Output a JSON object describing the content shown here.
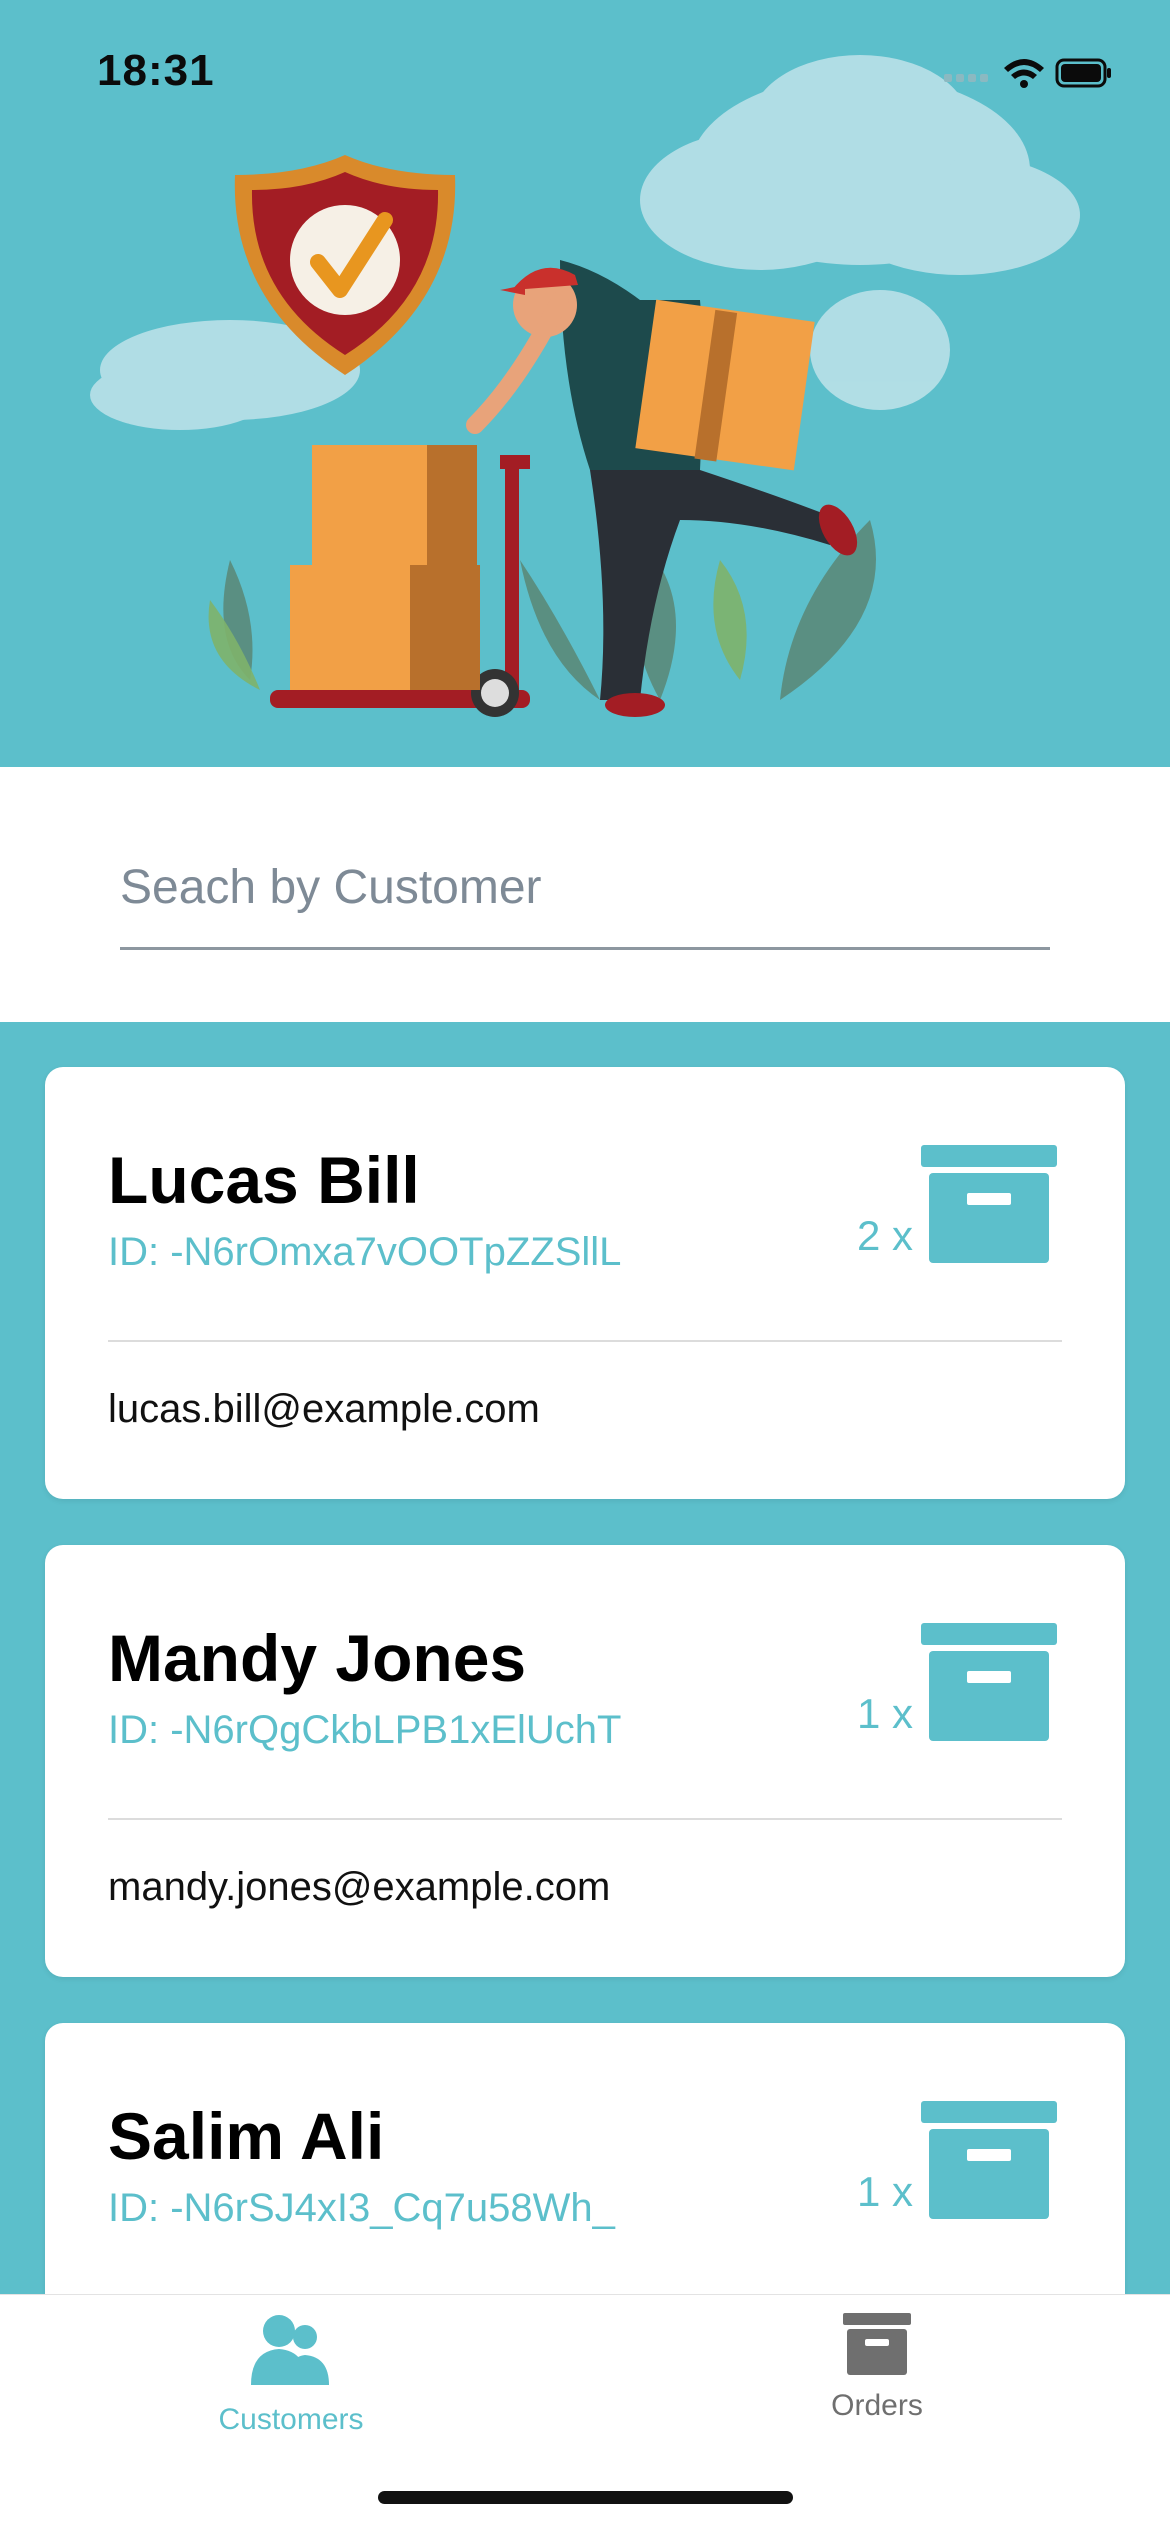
{
  "status_bar": {
    "time": "18:31"
  },
  "search": {
    "placeholder": "Seach by Customer"
  },
  "customers": [
    {
      "name": "Lucas Bill",
      "id": "ID: -N6rOmxa7vOOTpZZSllL",
      "quantity": "2 x",
      "email": "lucas.bill@example.com"
    },
    {
      "name": "Mandy Jones",
      "id": "ID: -N6rQgCkbLPB1xElUchT",
      "quantity": "1 x",
      "email": "mandy.jones@example.com"
    },
    {
      "name": "Salim Ali",
      "id": "ID: -N6rSJ4xI3_Cq7u58Wh_",
      "quantity": "1 x",
      "email": ""
    }
  ],
  "tabs": [
    {
      "label": "Customers",
      "icon": "customers-icon",
      "active": true
    },
    {
      "label": "Orders",
      "icon": "archive-box-icon",
      "active": false
    }
  ],
  "colors": {
    "accent": "#5cbfcb",
    "card": "#ffffff",
    "inactive": "#6f6f6f"
  }
}
